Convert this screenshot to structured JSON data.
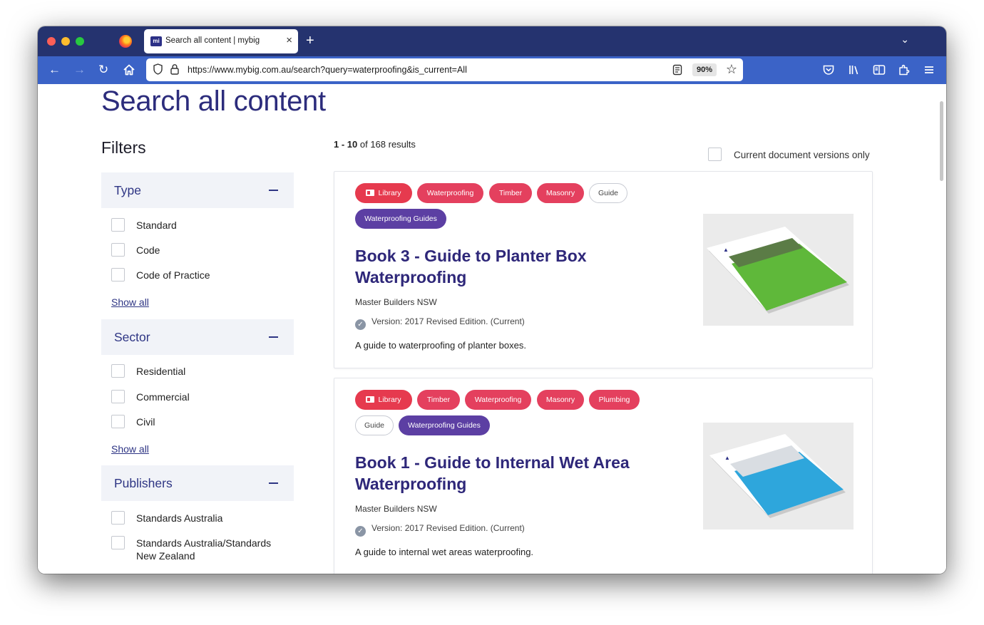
{
  "browser": {
    "tab_title": "Search all content | mybig",
    "favicon_text": "mi",
    "tab_close": "×",
    "new_tab": "+",
    "tab_list": "⌄",
    "url": "https://www.mybig.com.au/search?query=waterproofing&is_current=All",
    "zoom": "90%",
    "nav": {
      "back": "←",
      "forward": "→",
      "reload": "↻"
    },
    "star": "☆"
  },
  "page": {
    "title": "Search all content",
    "filters_title": "Filters",
    "filter_groups": [
      {
        "title": "Type",
        "items": [
          "Standard",
          "Code",
          "Code of Practice"
        ],
        "show_all": "Show all"
      },
      {
        "title": "Sector",
        "items": [
          "Residential",
          "Commercial",
          "Civil"
        ],
        "show_all": "Show all"
      },
      {
        "title": "Publishers",
        "items": [
          "Standards Australia",
          "Standards Australia/Standards",
          "New Zealand"
        ]
      }
    ],
    "results": {
      "range": "1 - 10",
      "of_text": " of 168 results",
      "current_only_label": "Current document versions only"
    },
    "cards": [
      {
        "tags": [
          "Library",
          "Waterproofing",
          "Timber",
          "Masonry",
          "Guide",
          "Waterproofing Guides"
        ],
        "title_line1": "Book 3 - Guide to Planter Box",
        "title_line2": "Waterproofing",
        "publisher": "Master Builders NSW",
        "version": "Version: 2017 Revised Edition. (Current)",
        "description": "A guide to waterproofing of planter boxes.",
        "cover_color": "#5fb83a"
      },
      {
        "tags": [
          "Library",
          "Timber",
          "Waterproofing",
          "Masonry",
          "Plumbing",
          "Guide",
          "Waterproofing Guides"
        ],
        "title_line1": "Book 1 - Guide to Internal Wet Area",
        "title_line2": "Waterproofing",
        "publisher": "Master Builders NSW",
        "version": "Version: 2017 Revised Edition. (Current)",
        "description": "A guide to internal wet areas waterproofing.",
        "cover_color": "#2ea6dc"
      }
    ]
  },
  "colors": {
    "tabstrip": "#25336f",
    "navbar": "#3b63c7",
    "brand_heading": "#2c2c7c",
    "tag_red": "#e4405e",
    "tag_purple": "#5c3fa3"
  }
}
